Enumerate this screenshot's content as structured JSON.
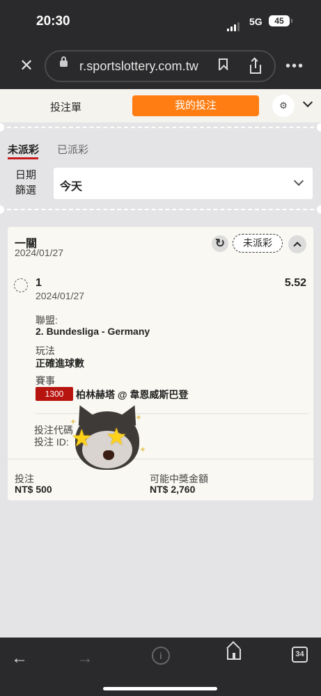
{
  "status_bar": {
    "time": "20:30",
    "network": "5G",
    "battery": "45"
  },
  "browser": {
    "url": "r.sportslottery.com.tw",
    "close_icon": "close-icon",
    "lock_icon": "lock-icon",
    "bookmark_icon": "bookmark-icon",
    "share_icon": "share-icon",
    "more_icon": "more-icon"
  },
  "tabs": {
    "bet_slip": "投注單",
    "my_bets": "我的投注",
    "active": "my_bets",
    "accent": "#ff7d12"
  },
  "filter_tabs": {
    "unsettled": "未派彩",
    "settled": "已派彩",
    "active_underline": "#c81a1a"
  },
  "date_filter": {
    "label_line1": "日期",
    "label_line2": "篩選",
    "selected": "今天"
  },
  "bet_card": {
    "type": "一關",
    "date": "2024/01/27",
    "status_badge": "未派彩",
    "selection": {
      "number": "1",
      "date": "2024/01/27",
      "odds": "5.52",
      "league_label": "聯盟:",
      "league_value": "2. Bundesliga - Germany",
      "market_label": "玩法",
      "market_value": "正確進球數",
      "event_label": "賽事",
      "event_code": "1300",
      "event_code_color": "#b8140f",
      "event_name": "柏林赫塔 @ 韋恩威斯巴登"
    },
    "bet_code_label": "投注代碼",
    "bet_id_label": "投注 ID:",
    "stake_label": "投注",
    "stake_value": "NT$ 500",
    "potential_label": "可能中獎金額",
    "potential_value": "NT$ 2,760"
  },
  "bottom_bar": {
    "tab_count": "34"
  }
}
